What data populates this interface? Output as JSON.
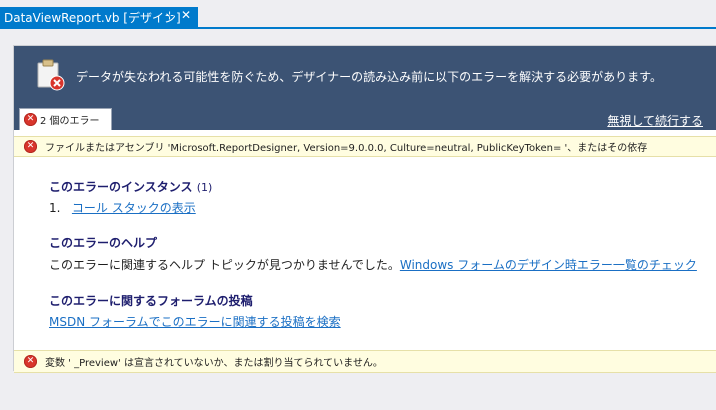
{
  "tab": {
    "title": "DataViewReport.vb [デザイン]",
    "pin_glyph": "⊹",
    "close_glyph": "✕"
  },
  "banner": {
    "message": "データが失なわれる可能性を防ぐため、デザイナーの読み込み前に以下のエラーを解決する必要があります。",
    "error_count_label": "2 個のエラー",
    "ignore_link": "無視して続行する"
  },
  "errors": [
    {
      "text": "ファイルまたはアセンブリ 'Microsoft.ReportDesigner, Version=9.0.0.0, Culture=neutral, PublicKeyToken=                    '、またはその依存"
    },
    {
      "text": "変数 '   _Preview' は宣言されていないか、または割り当てられていません。"
    }
  ],
  "details": {
    "instances_title": "このエラーのインスタンス",
    "instances_count": "(1)",
    "instance_number": "1.",
    "call_stack_link": "コール スタックの表示",
    "help_title": "このエラーのヘルプ",
    "help_text": "このエラーに関連するヘルプ トピックが見つかりませんでした。",
    "help_link": "Windows フォームのデザイン時エラー一覧のチェック",
    "forum_title": "このエラーに関するフォーラムの投稿",
    "forum_link": "MSDN フォーラムでこのエラーに関連する投稿を検索"
  },
  "colors": {
    "tab_accent": "#007acc",
    "banner_bg": "#3c5374",
    "error_row_bg": "#fffde0",
    "error_icon": "#d9352c",
    "link": "#1a6fc4"
  }
}
